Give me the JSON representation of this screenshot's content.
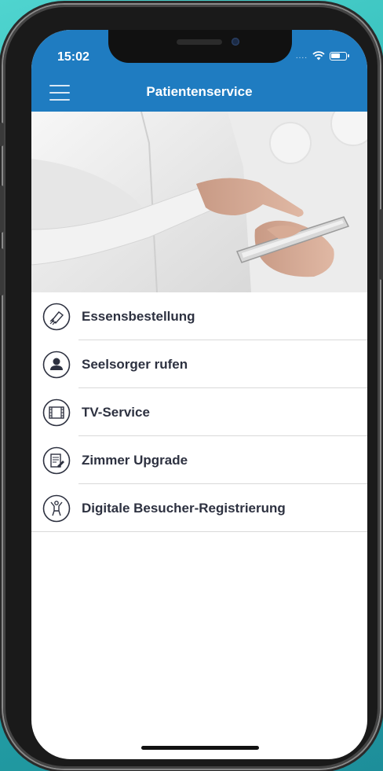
{
  "status_bar": {
    "time": "15:02",
    "signal": "....",
    "icons": [
      "wifi-icon",
      "battery-icon"
    ]
  },
  "nav": {
    "title": "Patientenservice",
    "menu_icon": "hamburger-menu-icon",
    "bar_color": "#1f7cc1"
  },
  "hero": {
    "image": "hand-holding-smartphone-photo"
  },
  "menu": {
    "items": [
      {
        "label": "Essensbestellung",
        "icon": "food-order-icon"
      },
      {
        "label": "Seelsorger rufen",
        "icon": "person-icon"
      },
      {
        "label": "TV-Service",
        "icon": "film-tv-icon"
      },
      {
        "label": "Zimmer Upgrade",
        "icon": "document-edit-icon"
      },
      {
        "label": "Digitale Besucher-Registrierung",
        "icon": "visitor-icon"
      }
    ]
  },
  "colors": {
    "background": "#2ab5b3",
    "text": "#2d3140",
    "divider": "#d9d9d9"
  }
}
